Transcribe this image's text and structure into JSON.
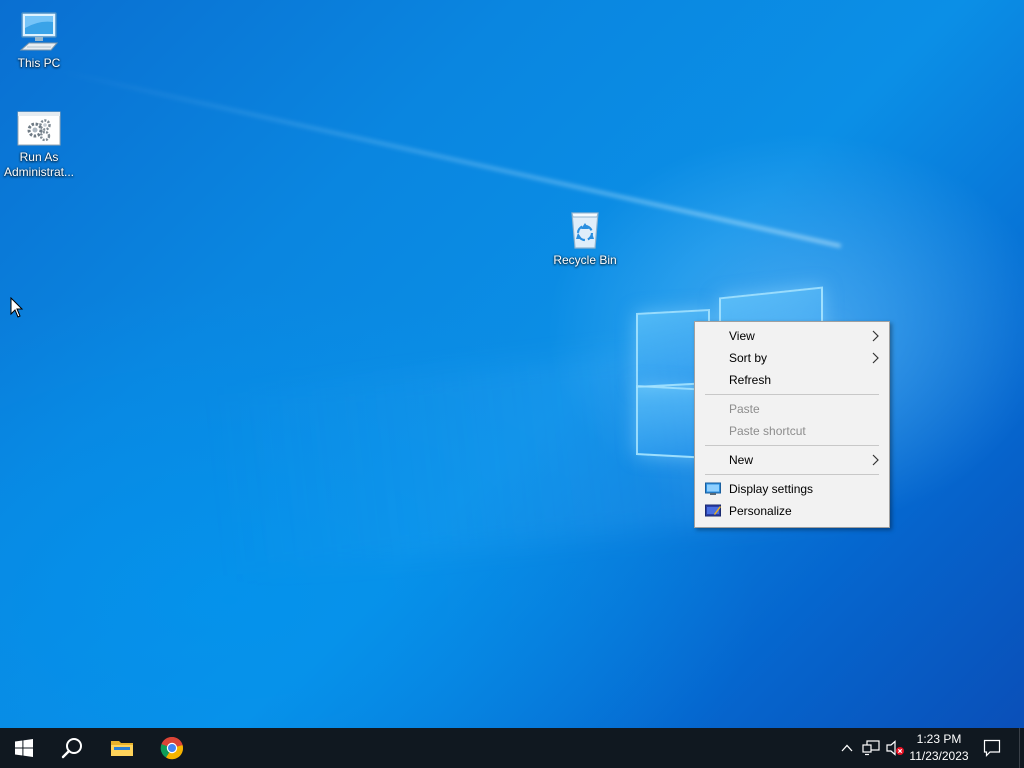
{
  "desktop": {
    "icons": [
      {
        "label": "This PC",
        "icon": "computer-icon"
      },
      {
        "label": "Run As\nAdministrat...",
        "icon": "gear-window-icon"
      },
      {
        "label": "Recycle Bin",
        "icon": "recycle-bin-icon"
      }
    ]
  },
  "context_menu": {
    "items": [
      {
        "label": "View",
        "submenu": true,
        "enabled": true
      },
      {
        "label": "Sort by",
        "submenu": true,
        "enabled": true
      },
      {
        "label": "Refresh",
        "enabled": true
      },
      {
        "label": "Paste",
        "enabled": false
      },
      {
        "label": "Paste shortcut",
        "enabled": false
      },
      {
        "label": "New",
        "submenu": true,
        "enabled": true
      },
      {
        "label": "Display settings",
        "icon": "display-icon",
        "enabled": true
      },
      {
        "label": "Personalize",
        "icon": "personalize-icon",
        "enabled": true
      }
    ]
  },
  "taskbar": {
    "buttons": [
      {
        "name": "start",
        "icon": "windows-logo-icon"
      },
      {
        "name": "search",
        "icon": "search-icon"
      },
      {
        "name": "file-explorer",
        "icon": "folder-icon"
      },
      {
        "name": "chrome",
        "icon": "chrome-icon"
      }
    ],
    "tray": {
      "icons": [
        "chevron-up-icon",
        "network-icon",
        "volume-muted-icon",
        "notification-icon"
      ],
      "time": "1:23 PM",
      "date": "11/23/2023"
    }
  },
  "colors": {
    "accent": "#0078d7",
    "taskbar": "#101820",
    "menu_bg": "#f2f2f2",
    "disabled_text": "#8d8d8d"
  }
}
